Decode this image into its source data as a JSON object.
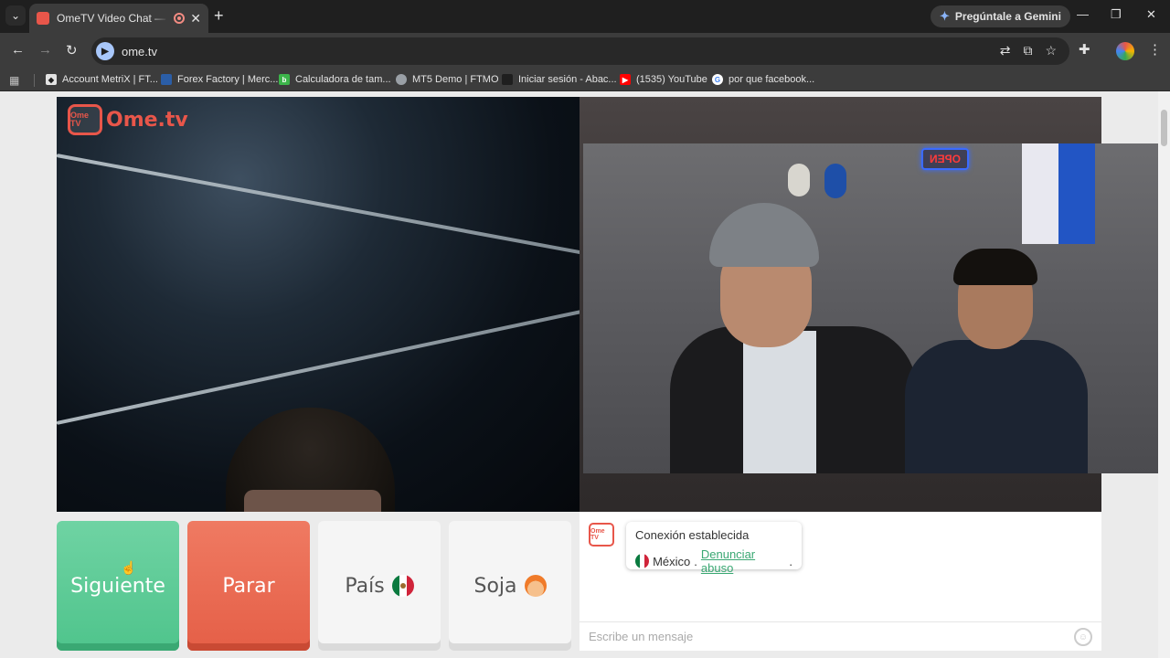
{
  "browser": {
    "tab_title": "OmeTV Video Chat — Alternativa a Chatroulette",
    "url": "ome.tv",
    "gemini_label": "Pregúntale a Gemini",
    "bookmarks": [
      {
        "label": "Account MetriX | FT...",
        "color": "#e3e3e3"
      },
      {
        "label": "Forex Factory | Merc...",
        "color": "#2b5ea7"
      },
      {
        "label": "Calculadora de tam...",
        "color": "#3cb54a"
      },
      {
        "label": "MT5 Demo | FTMO",
        "color": "#9aa0a6"
      },
      {
        "label": "Iniciar sesión - Abac...",
        "color": "#1f1f1f"
      },
      {
        "label": "(1535) YouTube",
        "color": "#ff0000"
      },
      {
        "label": "por que facebook...",
        "color": "#4285f4"
      }
    ]
  },
  "site": {
    "logo_badge": "Ome TV",
    "logo_text": "Ome.tv",
    "neon_sign": "OPEN"
  },
  "controls": {
    "next_label": "Siguiente",
    "stop_label": "Parar",
    "country_label": "País",
    "gender_label": "Soja"
  },
  "chat": {
    "logo_badge": "Ome TV",
    "status": "Conexión establecida",
    "country": "México",
    "separator": ".",
    "report_link": "Denunciar abuso",
    "trailing": ".",
    "input_placeholder": "Escribe un mensaje"
  },
  "icons": {
    "back": "arrow-left-icon",
    "forward": "arrow-right-icon",
    "reload": "reload-icon",
    "translate": "translate-icon",
    "install": "install-icon",
    "star": "star-icon",
    "extensions": "puzzle-icon",
    "menu": "kebab-menu-icon",
    "emoji": "smile-icon"
  },
  "colors": {
    "next": "#4fc48c",
    "stop": "#e55f47",
    "brand": "#e8564a",
    "link": "#3aa873"
  }
}
